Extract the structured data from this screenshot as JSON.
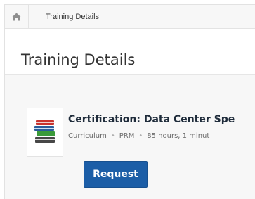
{
  "breadcrumb": {
    "current": "Training Details"
  },
  "page": {
    "title": "Training Details"
  },
  "training": {
    "title": "Certification: Data Center Spe",
    "type": "Curriculum",
    "provider": "PRM",
    "duration": "85 hours, 1 minut"
  },
  "actions": {
    "request_label": "Request"
  },
  "colors": {
    "accent": "#1c5ea7",
    "text": "#333333"
  },
  "icons": {
    "home": "home-icon",
    "thumbnail": "books-icon"
  }
}
